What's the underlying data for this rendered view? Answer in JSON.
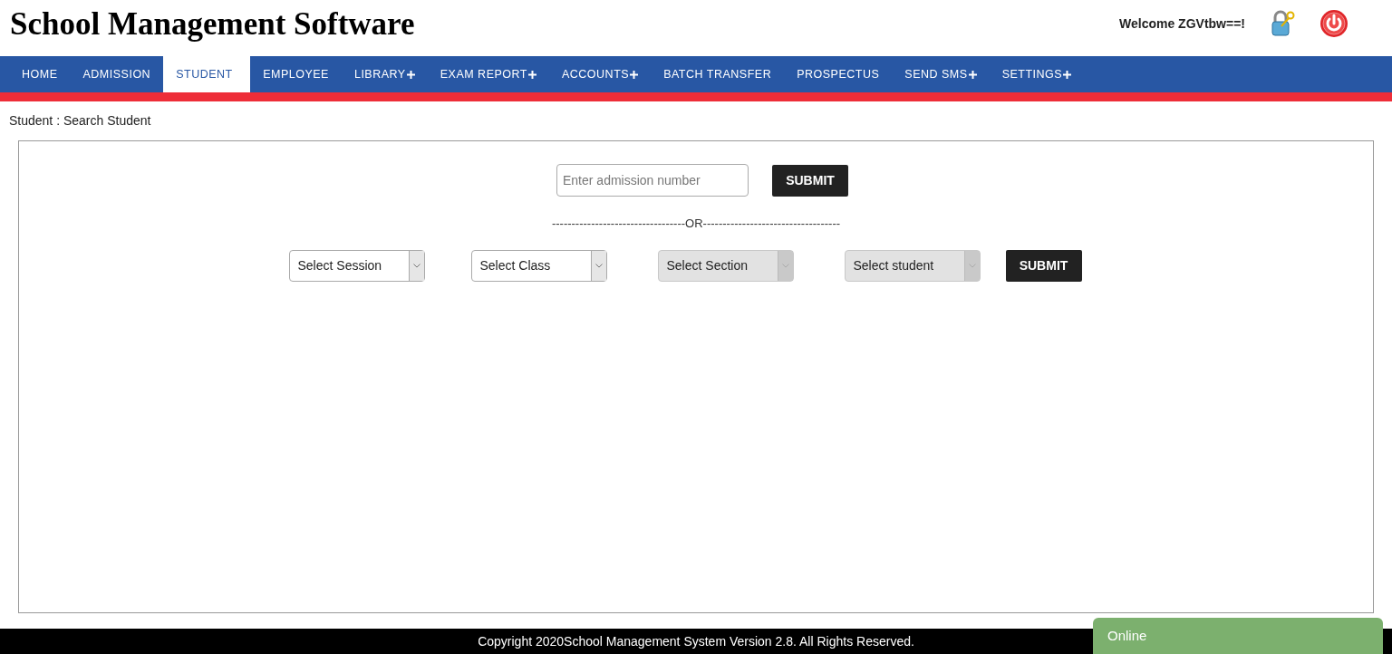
{
  "header": {
    "title": "School Management Software",
    "welcome": "Welcome ZGVtbw==!"
  },
  "nav": [
    {
      "label": "HOME",
      "selected": false,
      "submenu": false
    },
    {
      "label": "ADMISSION",
      "selected": false,
      "submenu": false
    },
    {
      "label": "STUDENT",
      "selected": true,
      "submenu": false
    },
    {
      "label": "EMPLOYEE",
      "selected": false,
      "submenu": false
    },
    {
      "label": "LIBRARY",
      "selected": false,
      "submenu": true
    },
    {
      "label": "EXAM REPORT",
      "selected": false,
      "submenu": true
    },
    {
      "label": "ACCOUNTS",
      "selected": false,
      "submenu": true
    },
    {
      "label": "BATCH TRANSFER",
      "selected": false,
      "submenu": false
    },
    {
      "label": "PROSPECTUS",
      "selected": false,
      "submenu": false
    },
    {
      "label": "SEND SMS",
      "selected": false,
      "submenu": true
    },
    {
      "label": "SETTINGS",
      "selected": false,
      "submenu": true
    }
  ],
  "breadcrumb": "Student : Search Student",
  "search": {
    "placeholder": "Enter admission number",
    "button": "SUBMIT"
  },
  "divider": "----------------------------------OR-----------------------------------",
  "selects": [
    {
      "value": "Select Session",
      "disabled": false
    },
    {
      "value": "Select Class",
      "disabled": false
    },
    {
      "value": "Select Section",
      "disabled": true
    },
    {
      "value": "Select student",
      "disabled": true
    }
  ],
  "submit": "SUBMIT",
  "footer": "Copyright 2020School Management System Version 2.8. All Rights Reserved.",
  "chat": {
    "status": "Online"
  }
}
